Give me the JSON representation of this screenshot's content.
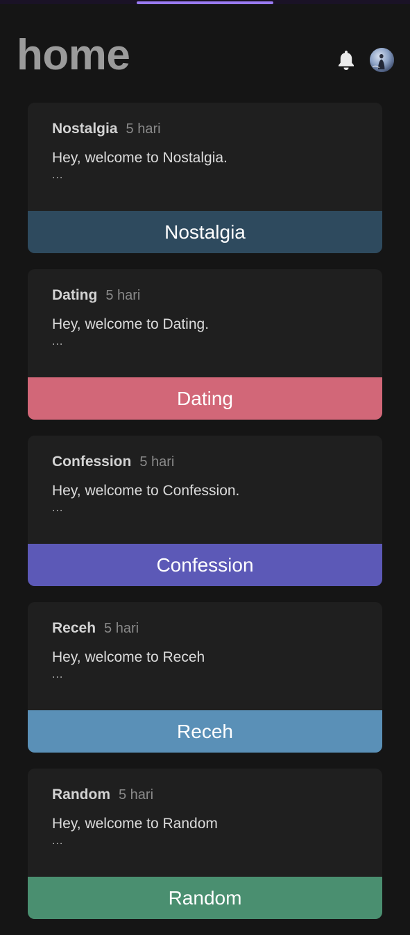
{
  "header": {
    "title": "home",
    "notification_icon": "bell-icon",
    "avatar_icon": "avatar"
  },
  "colors": {
    "background": "#151515",
    "card": "#1f1f1f",
    "accent": "#9a7bf2",
    "title": "#9b9b9b"
  },
  "feed": {
    "cards": [
      {
        "author": "Nostalgia",
        "time": "5 hari",
        "body": "Hey, welcome to Nostalgia.",
        "more": "...",
        "category": "Nostalgia",
        "category_color": "#2e4a5e"
      },
      {
        "author": "Dating",
        "time": "5 hari",
        "body": "Hey, welcome to Dating.",
        "more": "...",
        "category": "Dating",
        "category_color": "#d26778"
      },
      {
        "author": "Confession",
        "time": "5 hari",
        "body": "Hey, welcome to Confession.",
        "more": "...",
        "category": "Confession",
        "category_color": "#5c59b7"
      },
      {
        "author": "Receh",
        "time": "5 hari",
        "body": "Hey, welcome to Receh",
        "more": "...",
        "category": "Receh",
        "category_color": "#5a90b7"
      },
      {
        "author": "Random",
        "time": "5 hari",
        "body": "Hey, welcome to Random",
        "more": "...",
        "category": "Random",
        "category_color": "#4a8f70"
      }
    ]
  }
}
